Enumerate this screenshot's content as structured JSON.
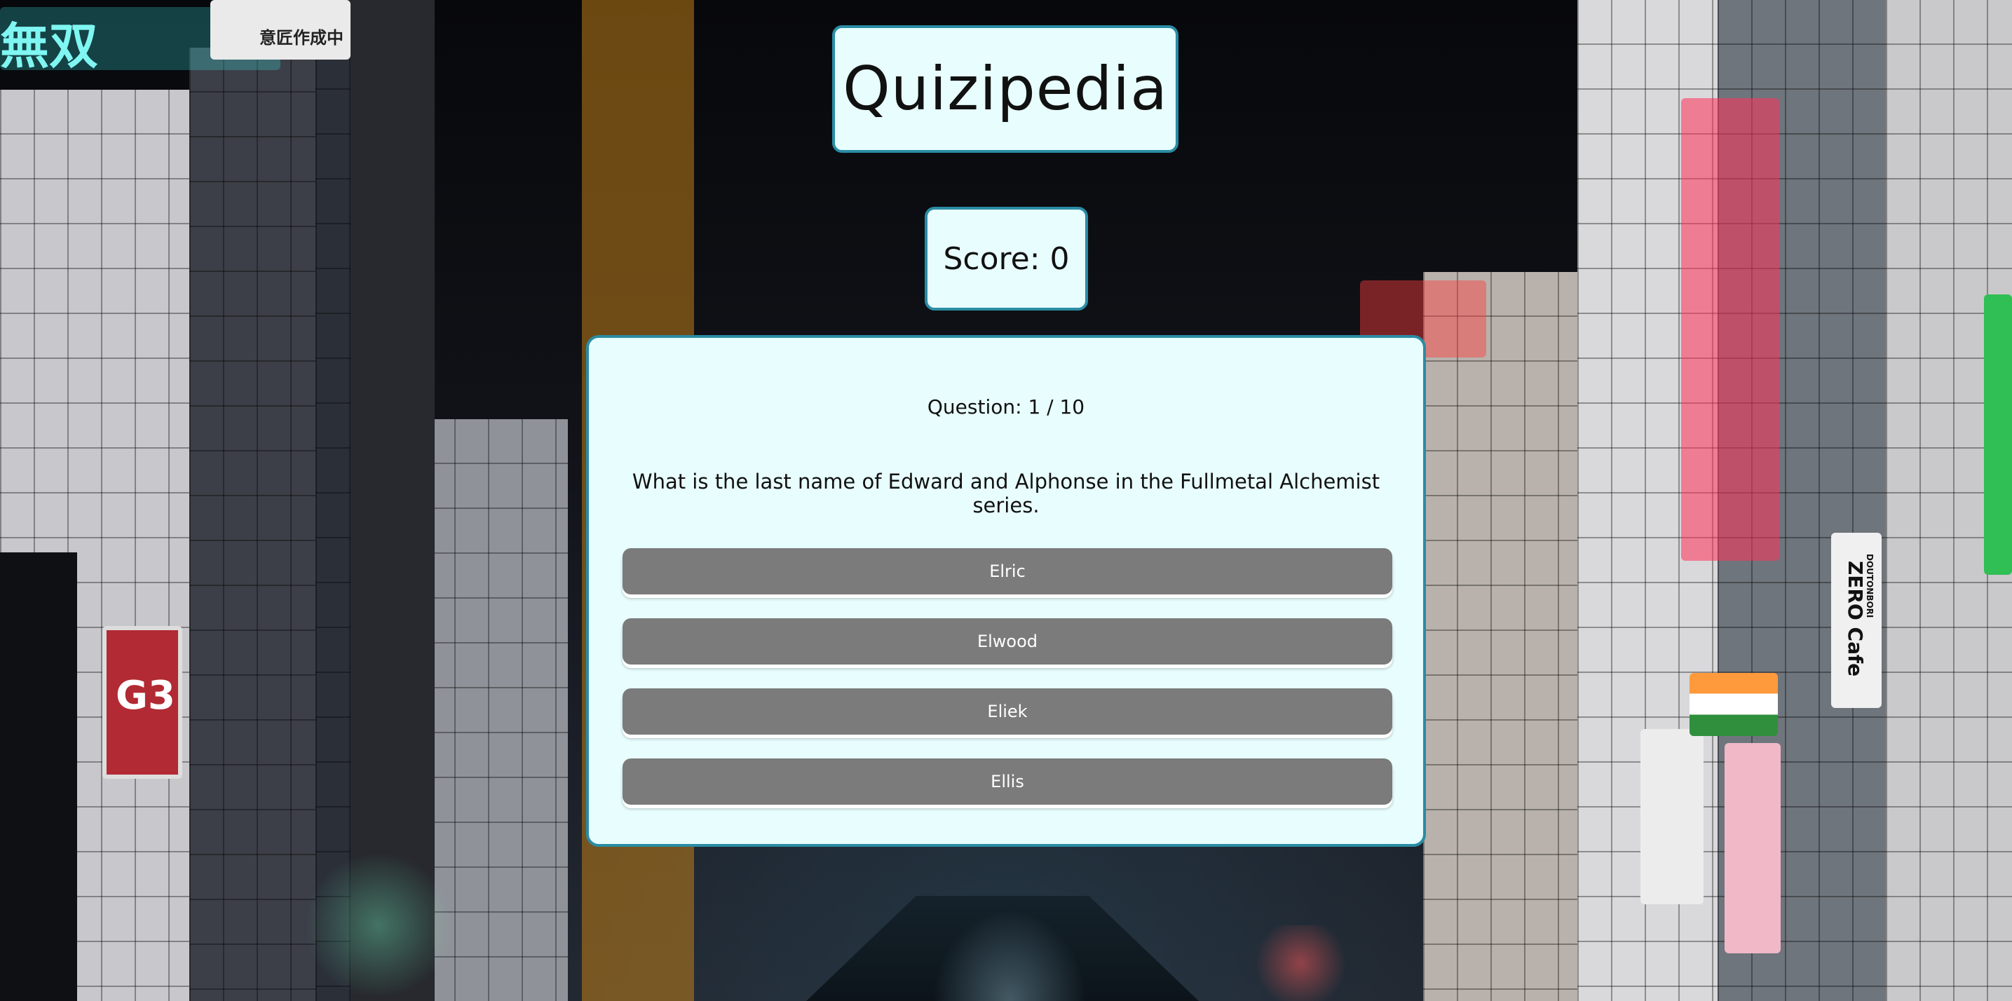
{
  "app": {
    "title": "Quizipedia"
  },
  "score": {
    "label": "Score: 0"
  },
  "quiz": {
    "counter": "Question: 1 / 10",
    "question": "What is the last name of Edward and Alphonse in the Fullmetal Alchemist series.",
    "answers": [
      {
        "label": "Elric"
      },
      {
        "label": "Elwood"
      },
      {
        "label": "Eliek"
      },
      {
        "label": "Ellis"
      }
    ]
  },
  "background": {
    "signs": {
      "top_left": "無双",
      "top_left_small": "意匠作成中",
      "g3": "G3",
      "zero_cafe": "ZERO Cafe",
      "dotonbori": "DOUTONBORI"
    }
  },
  "colors": {
    "panel_bg": "#e8fdfd",
    "panel_border": "#2a8ca4",
    "answer_bg": "#7b7b7b",
    "answer_text": "#ffffff"
  }
}
